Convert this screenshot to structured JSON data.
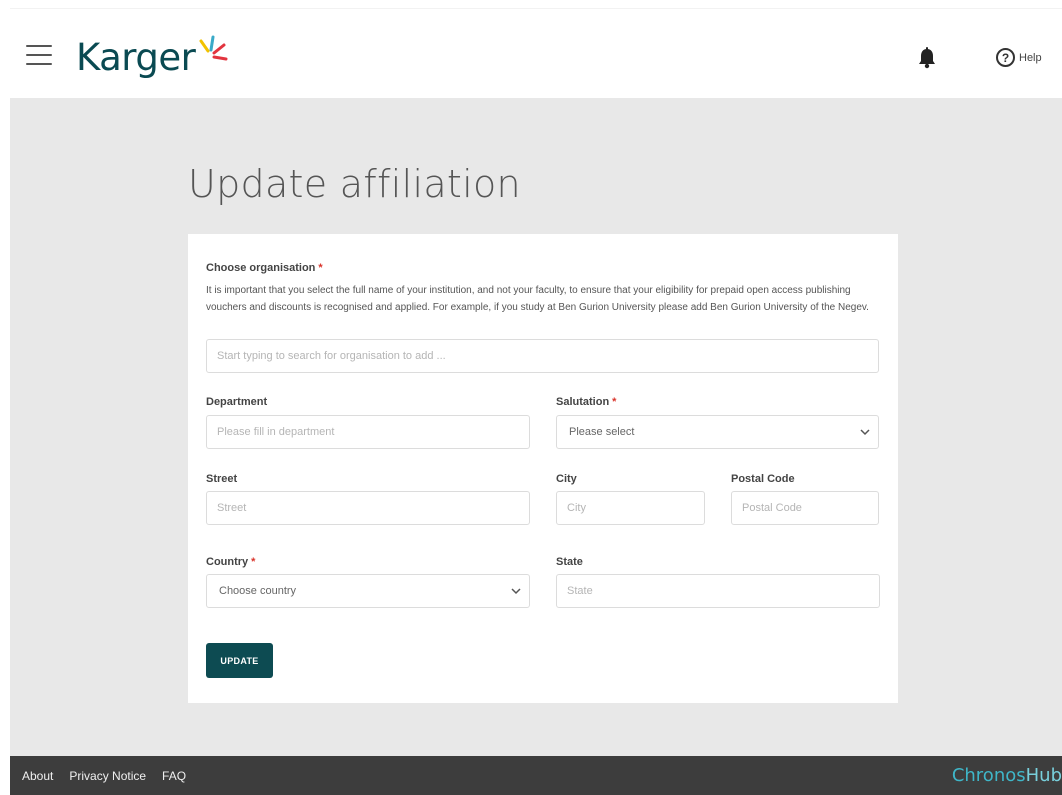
{
  "header": {
    "logo_text": "Karger",
    "brand_color": "#0a4a52",
    "help_label": "Help",
    "icons": [
      "menu-icon",
      "notification-bell-icon",
      "help-circle-icon"
    ]
  },
  "page": {
    "title": "Update affiliation"
  },
  "form": {
    "organisation": {
      "label": "Choose organisation",
      "required_mark": "*",
      "help_text": "It is important that you select the full name of your institution, and not your faculty, to ensure that your eligibility for prepaid open access publishing vouchers and discounts is recognised and applied. For example, if you study at Ben Gurion University please add Ben Gurion University of the Negev.",
      "placeholder": "Start typing to search for organisation to add ..."
    },
    "department": {
      "label": "Department",
      "placeholder": "Please fill in department"
    },
    "salutation": {
      "label": "Salutation",
      "required_mark": "*",
      "value": "Please select"
    },
    "street": {
      "label": "Street",
      "placeholder": "Street"
    },
    "city": {
      "label": "City",
      "placeholder": "City"
    },
    "postal_code": {
      "label": "Postal Code",
      "placeholder": "Postal Code"
    },
    "country": {
      "label": "Country",
      "required_mark": "*",
      "value": "Choose country"
    },
    "state": {
      "label": "State",
      "placeholder": "State"
    },
    "submit_label": "UPDATE",
    "button_color": "#0d4b52"
  },
  "footer": {
    "links": [
      "About",
      "Privacy Notice",
      "FAQ"
    ],
    "brand_part1": "Chronos",
    "brand_part2": "Hub",
    "brand_color": "#3fb6c8"
  }
}
